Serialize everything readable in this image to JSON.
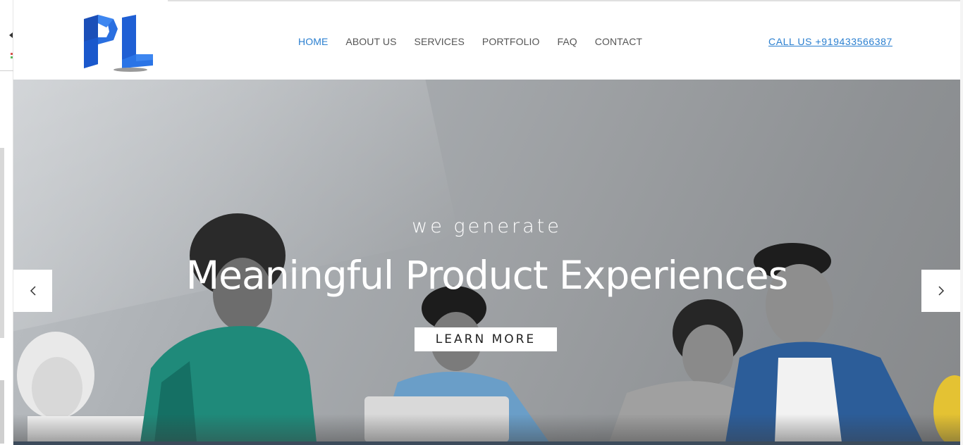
{
  "brand": {
    "logo_text": "PL",
    "primary_color": "#1a5fcc",
    "accent_color": "#2a7fd0"
  },
  "nav": {
    "items": [
      {
        "label": "HOME",
        "active": true
      },
      {
        "label": "ABOUT US",
        "active": false
      },
      {
        "label": "SERVICES",
        "active": false
      },
      {
        "label": "PORTFOLIO",
        "active": false
      },
      {
        "label": "FAQ",
        "active": false
      },
      {
        "label": "CONTACT",
        "active": false
      }
    ]
  },
  "header": {
    "call_label": "CALL US +919433566387"
  },
  "hero": {
    "eyebrow": "we generate",
    "headline": "Meaningful Product Experiences",
    "cta_label": "LEARN MORE",
    "prev_icon": "chevron-left-icon",
    "next_icon": "chevron-right-icon"
  }
}
